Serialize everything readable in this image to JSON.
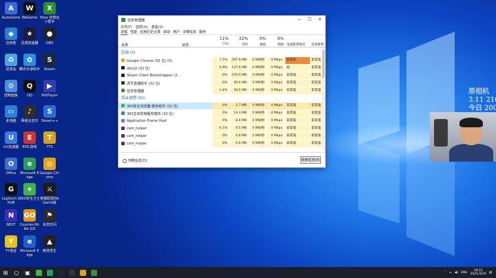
{
  "desktop_watermark": {
    "line1": "原相机",
    "line2": "3.11 210",
    "line3": "今日 200"
  },
  "desktop_icons": [
    {
      "label": "AutoGame",
      "color": "#3a6bd8",
      "glyph": "A"
    },
    {
      "label": "WeGame",
      "color": "#111111",
      "glyph": "W"
    },
    {
      "label": "Xbox 控制台小帮手",
      "color": "#2c8f2c",
      "glyph": "X"
    },
    {
      "label": "应用助",
      "color": "#2a7fd4",
      "glyph": "◆"
    },
    {
      "label": "迅游加速器",
      "color": "#1a1a3a",
      "glyph": "★"
    },
    {
      "label": "OBS",
      "color": "#222222",
      "glyph": "●"
    },
    {
      "label": "回收站",
      "color": "#4aa3e6",
      "glyph": "♻"
    },
    {
      "label": "腾讯手游助手",
      "color": "#2b8de0",
      "glyph": "✿"
    },
    {
      "label": "Steam",
      "color": "#1b2838",
      "glyph": "S"
    },
    {
      "label": "控制面板",
      "color": "#4b8be0",
      "glyph": "⚙"
    },
    {
      "label": "QQ",
      "color": "#111111",
      "glyph": "Q"
    },
    {
      "label": "PotPlayer",
      "color": "#3a3ab0",
      "glyph": "▶"
    },
    {
      "label": "此电脑",
      "color": "#2b7fd8",
      "glyph": "▭"
    },
    {
      "label": "网易云音乐",
      "color": "#2d2d2d",
      "glyph": "♪"
    },
    {
      "label": "Steam++",
      "color": "#2b6fd1",
      "glyph": "S"
    },
    {
      "label": "UU加速器",
      "color": "#3b78e0",
      "glyph": "U"
    },
    {
      "label": "EPIC游戏",
      "color": "#cc3333",
      "glyph": "E"
    },
    {
      "label": "TTS",
      "color": "#d9a21e",
      "glyph": "T"
    },
    {
      "label": "Office",
      "color": "#3d6ec9",
      "glyph": "O"
    },
    {
      "label": "Microsoft Edge",
      "color": "#2a9c5a",
      "glyph": "e"
    },
    {
      "label": "Google Chrome",
      "color": "#e0a21b",
      "glyph": "◎"
    },
    {
      "label": "Logitech G HUB",
      "color": "#111111",
      "glyph": "G"
    },
    {
      "label": "360安全卫士",
      "color": "#41b34a",
      "glyph": "+"
    },
    {
      "label": "英雄联盟WeGame版",
      "color": "#1b1b1b",
      "glyph": "⚔"
    },
    {
      "label": "NEXT",
      "color": "#3a2dbb",
      "glyph": "N"
    },
    {
      "label": "Counter-Strike GO",
      "color": "#d69a1e",
      "glyph": "GO"
    },
    {
      "label": "永劫无间",
      "color": "#2a2a2a",
      "glyph": "⚑"
    },
    {
      "label": "YY语音",
      "color": "#e6c21e",
      "glyph": "Y"
    },
    {
      "label": "Microsoft Edge",
      "color": "#1e5fc9",
      "glyph": "e"
    },
    {
      "label": "绝地求生",
      "color": "#222222",
      "glyph": "▲"
    }
  ],
  "task_manager": {
    "title": "任务管理器",
    "window_buttons": [
      "—",
      "☐",
      "✕"
    ],
    "menu": [
      "文件(F)",
      "选项(O)",
      "查看(V)"
    ],
    "tabs": [
      "进程",
      "性能",
      "应用历史记录",
      "启动",
      "用户",
      "详细信息",
      "服务"
    ],
    "active_tab": 0,
    "columns": {
      "name": "名称",
      "status": "状态",
      "cpu": {
        "pct": "11%",
        "label": "CPU"
      },
      "mem": {
        "pct": "32%",
        "label": "内存"
      },
      "disk": {
        "pct": "0%",
        "label": "磁盘"
      },
      "net": {
        "pct": "0%",
        "label": "网络"
      },
      "power": "电源使用情况",
      "power_trend": "电源使用"
    },
    "sections": [
      {
        "label": "应用 (5)",
        "rows": [
          {
            "name": "Google Chrome (32 位) (5)",
            "cpu": "7.5%",
            "mem": "397.8 MB",
            "disk": "0 MB/秒",
            "net": "0 Mbps",
            "power": "非常高",
            "trend": "非常低",
            "icon": "#e0a21b",
            "power_hot": true
          },
          {
            "name": "obs32 (32 位)",
            "cpu": "0.9%",
            "mem": "127.6 MB",
            "disk": "0 MB/秒",
            "net": "0 Mbps",
            "power": "低",
            "trend": "非常低",
            "icon": "#222222",
            "power_hot": false
          },
          {
            "name": "Steam Client Bootstrapper (3...",
            "cpu": "0%",
            "mem": "470.0 MB",
            "disk": "0 MB/秒",
            "net": "0 Mbps",
            "power": "非常低",
            "trend": "非常低",
            "icon": "#1b2838",
            "power_hot": false
          },
          {
            "name": "虎牙直播助手 (32 位)",
            "cpu": "0%",
            "mem": "40.6 MB",
            "disk": "0 MB/秒",
            "net": "0 Mbps",
            "power": "非常低",
            "trend": "非常低",
            "icon": "#333333",
            "power_hot": false
          },
          {
            "name": "任务管理器",
            "cpu": "1.4%",
            "mem": "28.0 MB",
            "disk": "0 MB/秒",
            "net": "0 Mbps",
            "power": "非常低",
            "trend": "非常低",
            "icon": "#3c8d3c",
            "power_hot": false
          }
        ]
      },
      {
        "label": "后台进程 (62)",
        "rows": [
          {
            "name": "360安全浏览器 服务组件 (32 位)",
            "cpu": "0%",
            "mem": "1.7 MB",
            "disk": "0 MB/秒",
            "net": "0 Mbps",
            "power": "非常低",
            "trend": "非常低",
            "icon": "#41b34a",
            "power_hot": false,
            "selected": true
          },
          {
            "name": "360主动防御服务模块 (32 位)",
            "cpu": "0%",
            "mem": "14.4 MB",
            "disk": "0 MB/秒",
            "net": "0 Mbps",
            "power": "非常低",
            "trend": "非常低",
            "icon": "#2e7fd6",
            "power_hot": false
          },
          {
            "name": "Application Frame Host",
            "cpu": "0%",
            "mem": "8.6 MB",
            "disk": "0 MB/秒",
            "net": "0 Mbps",
            "power": "非常低",
            "trend": "非常低",
            "icon": "#5a7fd4",
            "power_hot": false
          },
          {
            "name": "cam_helper",
            "cpu": "0.1%",
            "mem": "9.5 MB",
            "disk": "0 MB/秒",
            "net": "0 Mbps",
            "power": "非常低",
            "trend": "非常低",
            "icon": "#4b2a8a",
            "power_hot": false
          },
          {
            "name": "cam_helper",
            "cpu": "0%",
            "mem": "0.6 MB",
            "disk": "0 MB/秒",
            "net": "0 Mbps",
            "power": "非常低",
            "trend": "非常低",
            "icon": "#4b2a8a",
            "power_hot": false
          },
          {
            "name": "cam_helper",
            "cpu": "0%",
            "mem": "0.6 MB",
            "disk": "0 MB/秒",
            "net": "0 Mbps",
            "power": "非常低",
            "trend": "非常低",
            "icon": "#4b2a8a",
            "power_hot": false
          }
        ]
      }
    ],
    "fewer_details": "简略信息(D)",
    "end_task": "结束任务(E)"
  },
  "taskbar": {
    "apps": [
      {
        "name": "start",
        "glyph": "⊞",
        "color": "#ffffff"
      },
      {
        "name": "cortana",
        "glyph": "○",
        "color": "#ffffff"
      },
      {
        "name": "task-view",
        "glyph": "▣",
        "color": "#ffffff"
      },
      {
        "name": "360",
        "glyph": "",
        "color": "#41b34a"
      },
      {
        "name": "edge",
        "glyph": "",
        "color": "#2a9c5a"
      },
      {
        "name": "steam",
        "glyph": "",
        "color": "#1b2838"
      },
      {
        "name": "obs",
        "glyph": "",
        "color": "#333333"
      },
      {
        "name": "chrome",
        "glyph": "",
        "color": "#e0a21b"
      },
      {
        "name": "task-manager",
        "glyph": "",
        "color": "#3c8d3c"
      }
    ],
    "tray": {
      "lang": "ENG",
      "time": "18:12",
      "date": "2021/3/20"
    }
  }
}
